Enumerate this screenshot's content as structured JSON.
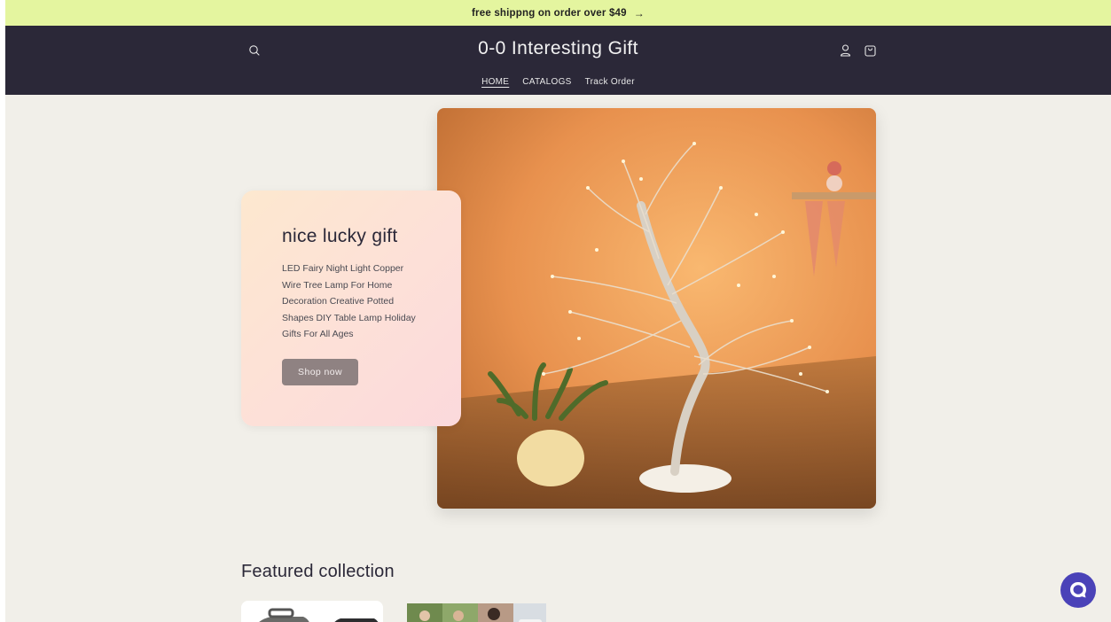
{
  "announcement": {
    "text": "free shippng on order over $49",
    "arrow": "→"
  },
  "header": {
    "logo": "0-0 Interesting Gift",
    "icons": [
      "search-icon",
      "account-icon",
      "cart-icon"
    ],
    "nav": [
      {
        "label": "HOME",
        "active": true
      },
      {
        "label": "CATALOGS",
        "active": false
      },
      {
        "label": "Track Order",
        "active": false
      }
    ]
  },
  "hero": {
    "title": "nice lucky gift",
    "description": "LED Fairy Night Light Copper Wire Tree Lamp For Home Decoration Creative Potted Shapes DIY Table Lamp Holiday Gifts For All Ages",
    "button_label": "Shop now"
  },
  "featured": {
    "title": "Featured collection"
  },
  "colors": {
    "announcement_bg": "#e4f59f",
    "header_bg": "#2b2838",
    "page_bg": "#f1efe9",
    "button_bg": "#8f8282",
    "chat_bg": "#4a42b8"
  }
}
